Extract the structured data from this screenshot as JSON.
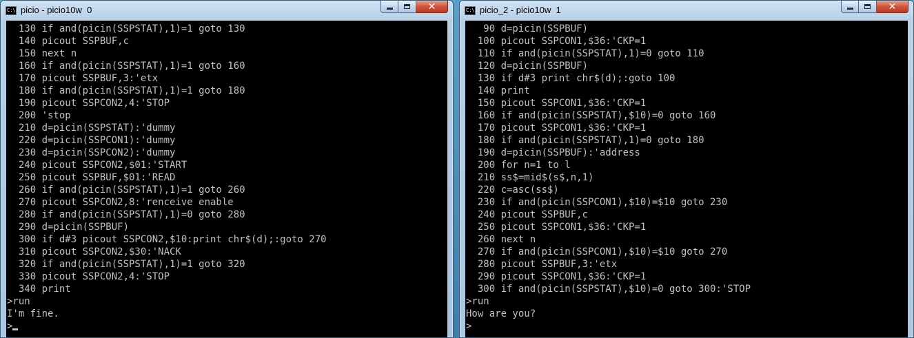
{
  "left_window": {
    "title": "picio - picio10w  0",
    "console_lines": [
      "  130 if and(picin(SSPSTAT),1)=1 goto 130",
      "  140 picout SSPBUF,c",
      "  150 next n",
      "  160 if and(picin(SSPSTAT),1)=1 goto 160",
      "  170 picout SSPBUF,3:'etx",
      "  180 if and(picin(SSPSTAT),1)=1 goto 180",
      "  190 picout SSPCON2,4:'STOP",
      "  200 'stop",
      "  210 d=picin(SSPSTAT):'dummy",
      "  220 d=picin(SSPCON1):'dummy",
      "  230 d=picin(SSPCON2):'dummy",
      "  240 picout SSPCON2,$01:'START",
      "  250 picout SSPBUF,$01:'READ",
      "  260 if and(picin(SSPSTAT),1)=1 goto 260",
      "  270 picout SSPCON2,8:'renceive enable",
      "  280 if and(picin(SSPSTAT),1)=0 goto 280",
      "  290 d=picin(SSPBUF)",
      "  300 if d#3 picout SSPCON2,$10:print chr$(d);:goto 270",
      "  310 picout SSPCON2,$30:'NACK",
      "  320 if and(picin(SSPSTAT),1)=1 goto 320",
      "  330 picout SSPCON2,4:'STOP",
      "  340 print",
      ">run",
      "I'm fine."
    ],
    "prompt": ">"
  },
  "right_window": {
    "title": "picio_2 - picio10w  1",
    "console_lines": [
      "   90 d=picin(SSPBUF)",
      "  100 picout SSPCON1,$36:'CKP=1",
      "  110 if and(picin(SSPSTAT),1)=0 goto 110",
      "  120 d=picin(SSPBUF)",
      "  130 if d#3 print chr$(d);:goto 100",
      "  140 print",
      "  150 picout SSPCON1,$36:'CKP=1",
      "  160 if and(picin(SSPSTAT),$10)=0 goto 160",
      "  170 picout SSPCON1,$36:'CKP=1",
      "  180 if and(picin(SSPSTAT),1)=0 goto 180",
      "  190 d=picin(SSPBUF):'address",
      "  200 for n=1 to l",
      "  210 ss$=mid$(s$,n,1)",
      "  220 c=asc(ss$)",
      "  230 if and(picin(SSPCON1),$10)=$10 goto 230",
      "  240 picout SSPBUF,c",
      "  250 picout SSPCON1,$36:'CKP=1",
      "  260 next n",
      "  270 if and(picin(SSPCON1),$10)=$10 goto 270",
      "  280 picout SSPBUF,3:'etx",
      "  290 picout SSPCON1,$36:'CKP=1",
      "  300 if and(picin(SSPSTAT),$10)=0 goto 300:'STOP",
      ">run",
      "How are you?"
    ],
    "prompt": ">"
  },
  "app_icon_text": "C:\\.",
  "controls": {
    "close_glyph": "✕"
  },
  "colors": {
    "console_bg": "#000000",
    "console_text": "#c0c0c0",
    "close_button": "#c8442a"
  }
}
